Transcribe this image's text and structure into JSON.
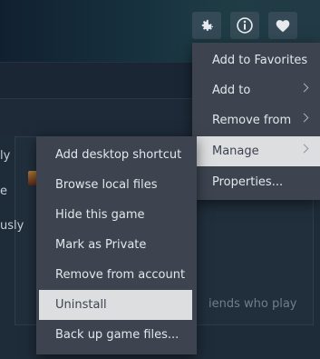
{
  "header": {
    "icons": [
      "gear-icon",
      "info-icon",
      "heart-icon"
    ]
  },
  "background": {
    "left_fragments": [
      "ly",
      "e",
      "usly"
    ],
    "friends_text": "iends who play"
  },
  "context_menu": {
    "items": [
      {
        "label": "Add to Favorites",
        "submenu": false
      },
      {
        "label": "Add to",
        "submenu": true
      },
      {
        "label": "Remove from",
        "submenu": true
      },
      {
        "label": "Manage",
        "submenu": true,
        "highlighted": true
      },
      {
        "label": "Properties...",
        "submenu": false
      }
    ]
  },
  "manage_submenu": {
    "items": [
      {
        "label": "Add desktop shortcut"
      },
      {
        "label": "Browse local files"
      },
      {
        "label": "Hide this game"
      },
      {
        "label": "Mark as Private"
      },
      {
        "label": "Remove from account"
      },
      {
        "label": "Uninstall",
        "highlighted": true
      },
      {
        "label": "Back up game files..."
      }
    ]
  },
  "colors": {
    "menu_bg": "#3d4450",
    "menu_highlight": "#dcdedf",
    "menu_text": "#e3e7eb"
  }
}
